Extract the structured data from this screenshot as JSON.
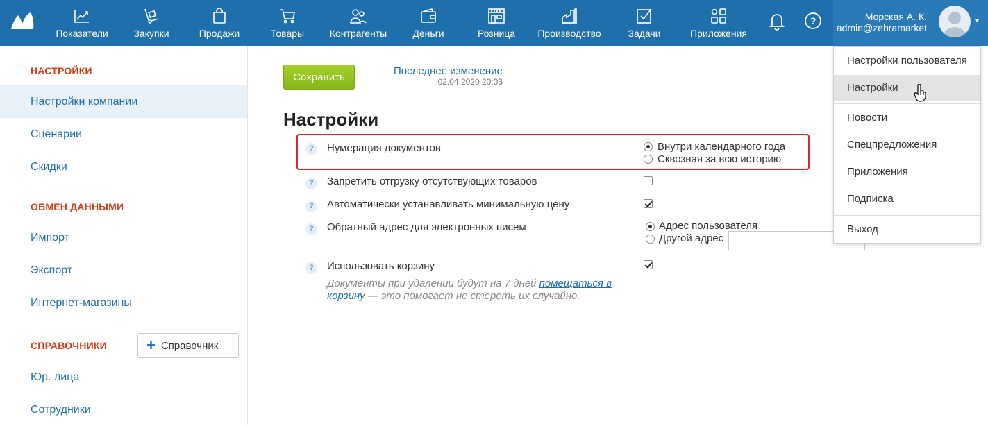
{
  "nav": {
    "items": [
      {
        "label": "Показатели",
        "icon": "chart-line-icon"
      },
      {
        "label": "Закупки",
        "icon": "hand-truck-icon"
      },
      {
        "label": "Продажи",
        "icon": "shopping-bag-icon"
      },
      {
        "label": "Товары",
        "icon": "shopping-cart-icon"
      },
      {
        "label": "Контрагенты",
        "icon": "people-icon"
      },
      {
        "label": "Деньги",
        "icon": "wallet-icon"
      },
      {
        "label": "Розница",
        "icon": "store-icon"
      },
      {
        "label": "Производство",
        "icon": "factory-icon"
      },
      {
        "label": "Задачи",
        "icon": "checkbox-icon"
      },
      {
        "label": "Приложения",
        "icon": "apps-icon"
      }
    ]
  },
  "user": {
    "name": "Морская А. К.",
    "email": "admin@zebramarket"
  },
  "sidebar": {
    "sections": [
      {
        "title": "НАСТРОЙКИ",
        "items": [
          "Настройки компании",
          "Сценарии",
          "Скидки"
        ]
      },
      {
        "title": "ОБМЕН ДАННЫМИ",
        "items": [
          "Импорт",
          "Экспорт",
          "Интернет-магазины"
        ]
      },
      {
        "title": "СПРАВОЧНИКИ",
        "items": [
          "Юр. лица",
          "Сотрудники"
        ],
        "add_button": "Справочник"
      }
    ],
    "active_item": "Настройки компании"
  },
  "main": {
    "save_label": "Сохранить",
    "last_change_label": "Последнее изменение",
    "last_change_date": "02.04.2020 20:03",
    "title": "Настройки",
    "settings": {
      "doc_numbering": {
        "label": "Нумерация документов",
        "options": [
          "Внутри календарного года",
          "Сквозная за всю историю"
        ],
        "selected": "Внутри календарного года"
      },
      "forbid_shipment": {
        "label": "Запретить отгрузку отсутствующих товаров",
        "checked": false
      },
      "auto_min_price": {
        "label": "Автоматически устанавливать минимальную цену",
        "checked": true
      },
      "reply_address": {
        "label": "Обратный адрес для электронных писем",
        "options": [
          "Адрес пользователя",
          "Другой адрес"
        ],
        "selected": "Адрес пользователя",
        "other_value": ""
      },
      "use_trash": {
        "label": "Использовать корзину",
        "checked": true,
        "note_before": "Документы при удалении будут на 7 дней ",
        "note_link": "помещаться в корзину",
        "note_after": " — это помогает не стереть их случайно."
      }
    }
  },
  "user_menu": {
    "items": [
      "Настройки пользователя",
      "Настройки",
      "Новости",
      "Спецпредложения",
      "Приложения",
      "Подписка",
      "Выход"
    ],
    "hovered": "Настройки"
  },
  "colors": {
    "topbar": "#1f6fac",
    "accent_red": "#d4401a",
    "save_green": "#8cbd1a",
    "highlight_border": "#e0242b"
  }
}
